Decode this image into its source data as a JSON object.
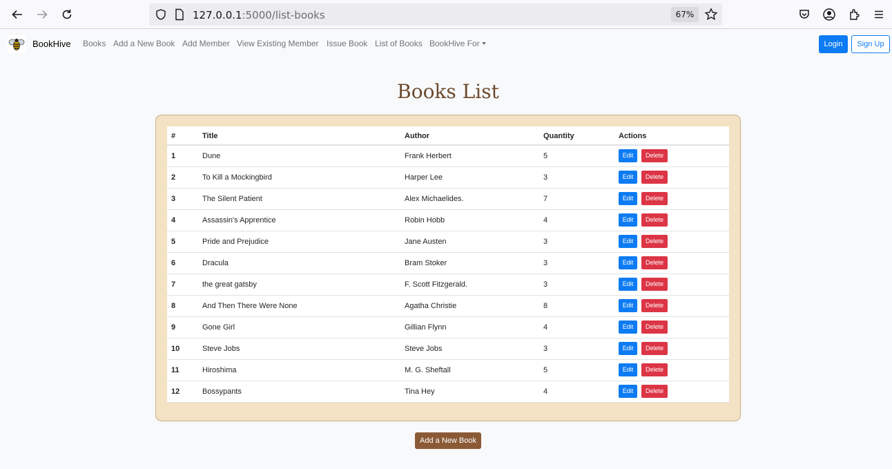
{
  "browser": {
    "url_host": "127.0.0.1",
    "url_rest": ":5000/list-books",
    "zoom": "67%"
  },
  "navbar": {
    "brand": "BookHive",
    "links": [
      "Books",
      "Add a New Book",
      "Add Member",
      "View Existing Member",
      "Issue Book",
      "List of Books",
      "BookHive For"
    ],
    "login": "Login",
    "signup": "Sign Up"
  },
  "page": {
    "title": "Books List",
    "add_button": "Add a New Book"
  },
  "table": {
    "headers": [
      "#",
      "Title",
      "Author",
      "Quantity",
      "Actions"
    ],
    "edit_label": "Edit",
    "delete_label": "Delete",
    "rows": [
      {
        "num": "1",
        "title": "Dune",
        "author": "Frank Herbert",
        "qty": "5"
      },
      {
        "num": "2",
        "title": "To Kill a Mockingbird",
        "author": "Harper Lee",
        "qty": "3"
      },
      {
        "num": "3",
        "title": "The Silent Patient",
        "author": "Alex Michaelides.",
        "qty": "7"
      },
      {
        "num": "4",
        "title": "Assassin's Apprentice",
        "author": "Robin Hobb",
        "qty": "4"
      },
      {
        "num": "5",
        "title": "Pride and Prejudice",
        "author": "Jane Austen",
        "qty": "3"
      },
      {
        "num": "6",
        "title": "Dracula",
        "author": "Bram Stoker",
        "qty": "3"
      },
      {
        "num": "7",
        "title": "the great gatsby",
        "author": "F. Scott Fitzgerald.",
        "qty": "3"
      },
      {
        "num": "8",
        "title": "And Then There Were None",
        "author": "Agatha Christie",
        "qty": "8"
      },
      {
        "num": "9",
        "title": "Gone Girl",
        "author": "Gillian Flynn",
        "qty": "4"
      },
      {
        "num": "10",
        "title": "Steve Jobs",
        "author": "Steve Jobs",
        "qty": "3"
      },
      {
        "num": "11",
        "title": "Hiroshima",
        "author": "M. G. Sheftall",
        "qty": "5"
      },
      {
        "num": "12",
        "title": "Bossypants",
        "author": "Tina Hey",
        "qty": "4"
      }
    ]
  }
}
